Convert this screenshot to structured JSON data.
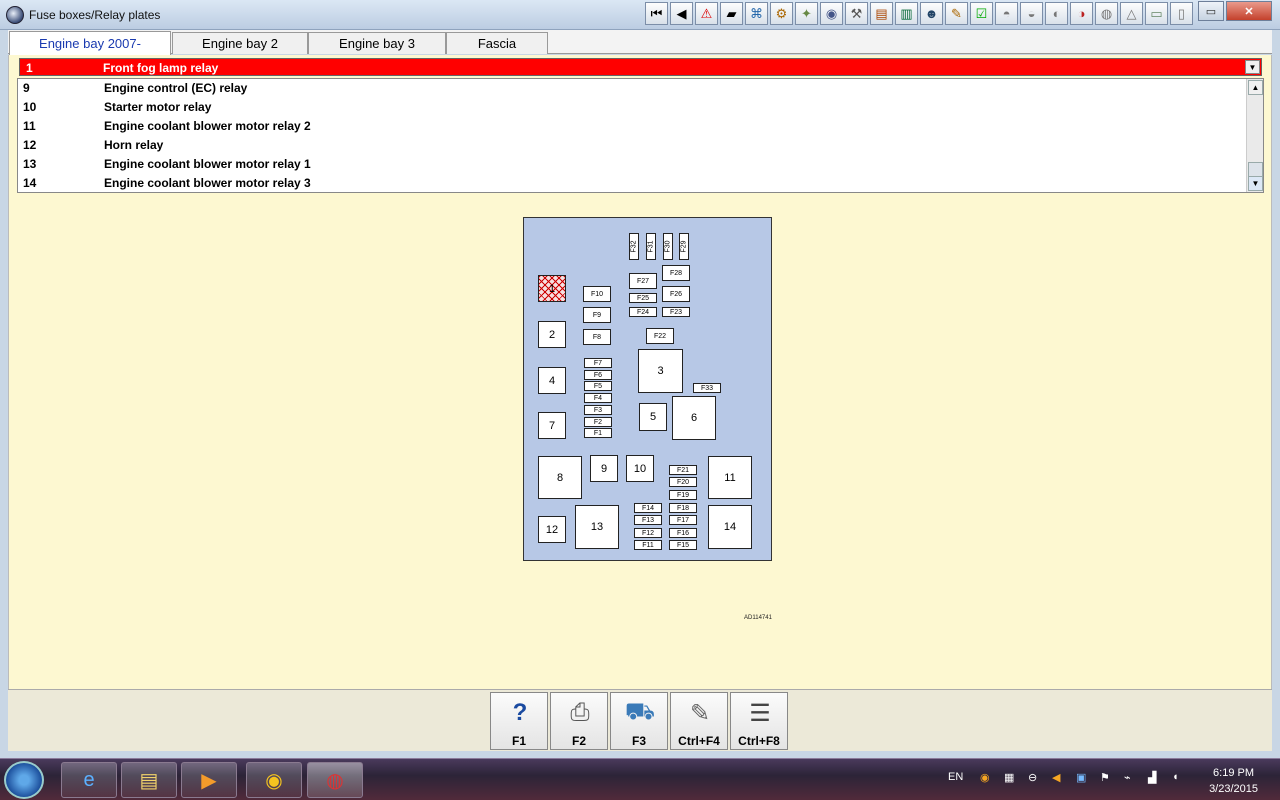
{
  "window": {
    "title": "Fuse boxes/Relay plates"
  },
  "toolbar": {
    "buttons": [
      "first-page-icon",
      "previous-icon",
      "warning-icon",
      "info-icon",
      "network-icon",
      "settings-icon",
      "tool-icon",
      "gauge-icon",
      "wrench-icon",
      "chart-icon",
      "book-icon",
      "people-icon",
      "edit-icon",
      "report-icon",
      "car-icon",
      "car-service-icon",
      "car-tools-icon",
      "car-alert-icon",
      "lamp-icon",
      "triangle-icon",
      "battery-icon",
      "document-icon"
    ]
  },
  "tabs": [
    {
      "label": "Engine bay 2007-"
    },
    {
      "label": "Engine bay 2"
    },
    {
      "label": "Engine bay 3"
    },
    {
      "label": "Fascia"
    }
  ],
  "selected": {
    "num": "1",
    "desc": "Front fog lamp relay"
  },
  "list": [
    {
      "num": "9",
      "desc": "Engine control (EC) relay"
    },
    {
      "num": "10",
      "desc": "Starter motor relay"
    },
    {
      "num": "11",
      "desc": "Engine coolant blower motor relay 2"
    },
    {
      "num": "12",
      "desc": "Horn relay"
    },
    {
      "num": "13",
      "desc": "Engine coolant blower motor relay 1"
    },
    {
      "num": "14",
      "desc": "Engine coolant blower motor relay 3"
    }
  ],
  "diagram": {
    "reference": "AD114741",
    "relays": {
      "r1": "1",
      "r2": "2",
      "r3": "3",
      "r4": "4",
      "r5": "5",
      "r6": "6",
      "r7": "7",
      "r8": "8",
      "r9": "9",
      "r10": "10",
      "r11": "11",
      "r12": "12",
      "r13": "13",
      "r14": "14"
    },
    "fuses": {
      "F1": "F1",
      "F2": "F2",
      "F3": "F3",
      "F4": "F4",
      "F5": "F5",
      "F6": "F6",
      "F7": "F7",
      "F8": "F8",
      "F9": "F9",
      "F10": "F10",
      "F11": "F11",
      "F12": "F12",
      "F13": "F13",
      "F14": "F14",
      "F15": "F15",
      "F16": "F16",
      "F17": "F17",
      "F18": "F18",
      "F19": "F19",
      "F20": "F20",
      "F21": "F21",
      "F22": "F22",
      "F23": "F23",
      "F24": "F24",
      "F25": "F25",
      "F26": "F26",
      "F27": "F27",
      "F28": "F28",
      "F29": "F29",
      "F30": "F30",
      "F31": "F31",
      "F32": "F32",
      "F33": "F33"
    }
  },
  "function_keys": [
    {
      "key": "F1",
      "icon": "help-icon"
    },
    {
      "key": "F2",
      "icon": "printer-icon"
    },
    {
      "key": "F3",
      "icon": "car-icon"
    },
    {
      "key": "Ctrl+F4",
      "icon": "notes-icon"
    },
    {
      "key": "Ctrl+F8",
      "icon": "table-icon"
    }
  ],
  "taskbar": {
    "lang": "EN",
    "time": "6:19 PM",
    "date": "3/23/2015"
  }
}
